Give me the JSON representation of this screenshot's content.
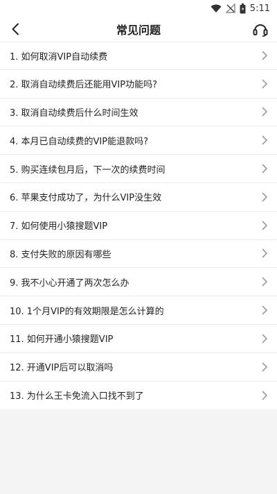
{
  "status_bar": {
    "time": "5:11",
    "icons": [
      "wifi-icon",
      "no-signal-icon",
      "battery-icon"
    ]
  },
  "header": {
    "title": "常见问题",
    "back_icon": "chevron-left-icon",
    "service_icon": "headset-icon"
  },
  "faq": {
    "items": [
      {
        "label": "1. 如何取消VIP自动续费"
      },
      {
        "label": "2. 取消自动续费后还能用VIP功能吗?"
      },
      {
        "label": "3. 取消自动续费后什么时间生效"
      },
      {
        "label": "4. 本月已自动续费的VIP能退款吗?"
      },
      {
        "label": "5. 购买连续包月后，下一次的续费时间"
      },
      {
        "label": "6. 苹果支付成功了，为什么VIP没生效"
      },
      {
        "label": "7. 如何使用小猿搜题VIP"
      },
      {
        "label": "8. 支付失败的原因有哪些"
      },
      {
        "label": "9. 我不小心开通了两次怎么办"
      },
      {
        "label": "10. 1个月VIP的有效期限是怎么计算的"
      },
      {
        "label": "11. 如何开通小猿搜题VIP"
      },
      {
        "label": "12. 开通VIP后可以取消吗"
      },
      {
        "label": "13. 为什么王卡免流入口找不到了"
      }
    ]
  },
  "colors": {
    "background": "#f4f4f4",
    "surface": "#ffffff",
    "divider": "#ececec",
    "text": "#222222",
    "chevron": "#999999"
  }
}
